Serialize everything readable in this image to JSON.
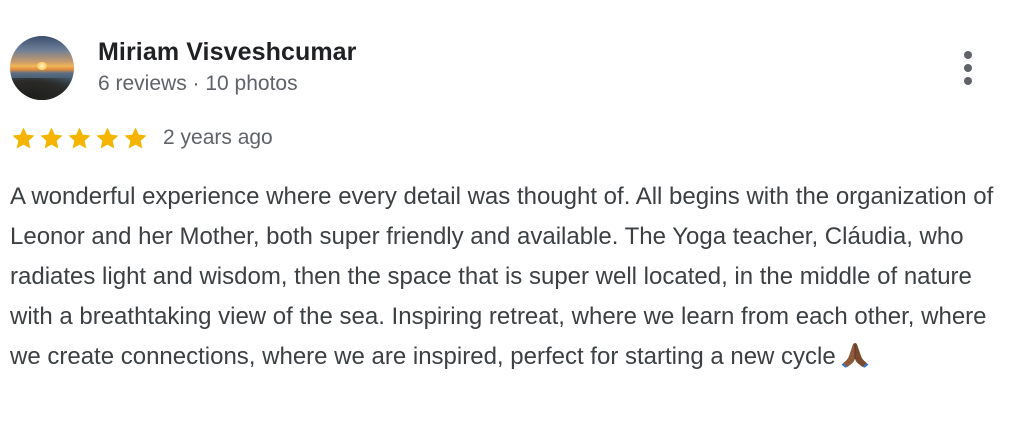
{
  "reviewer": {
    "name": "Miriam Visveshcumar",
    "meta": "6 reviews · 10 photos"
  },
  "rating": {
    "stars": 5,
    "max_stars": 5,
    "star_color": "#F4B400",
    "time": "2 years ago"
  },
  "review": {
    "text": "A wonderful experience where every detail was thought of. All begins with the organization of Leonor and her Mother, both super friendly and available. The Yoga teacher, Cláudia, who radiates light and wisdom, then the space that is super well located, in the middle of nature with a breathtaking view of the sea. Inspiring retreat, where we learn from each other, where we create connections, where we are inspired, perfect for starting a new cycle",
    "emoji_icon": "folded-hands-icon"
  },
  "icons": {
    "more_menu": "more-vert-icon"
  }
}
